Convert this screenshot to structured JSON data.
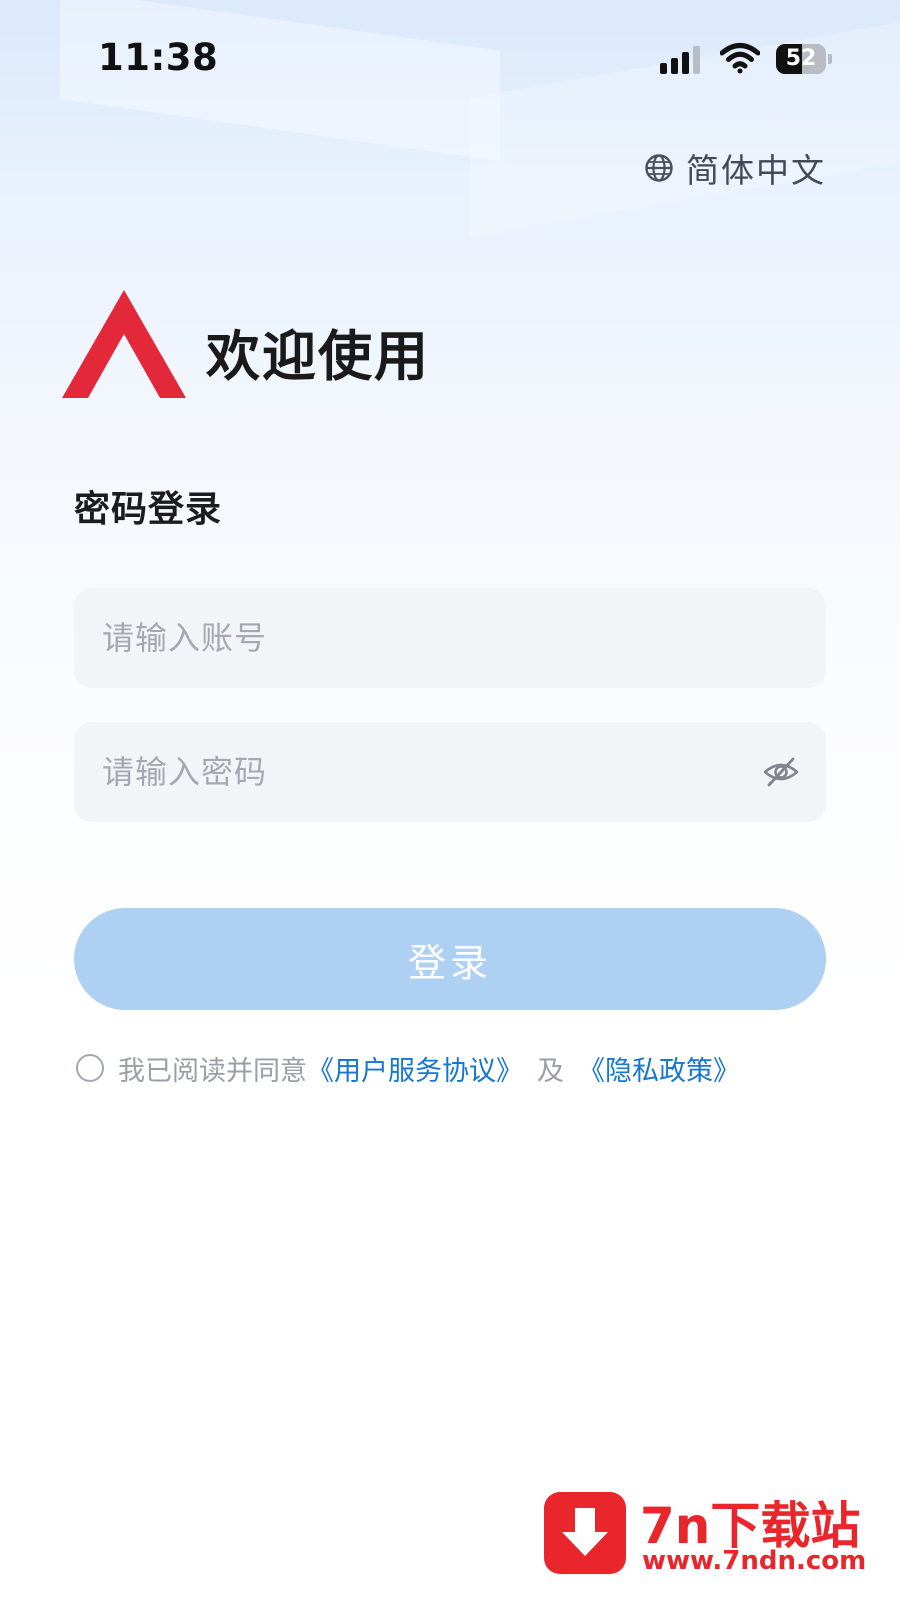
{
  "status_bar": {
    "time": "11:38",
    "battery_level": "52",
    "battery_fraction": 0.52
  },
  "language": {
    "icon": "globe-icon",
    "label": "简体中文"
  },
  "header": {
    "welcome": "欢迎使用"
  },
  "login": {
    "title": "密码登录",
    "account_placeholder": "请输入账号",
    "account_value": "",
    "password_placeholder": "请输入密码",
    "password_value": "",
    "password_toggle_icon": "eye-off-icon",
    "submit_label": "登录"
  },
  "agreement": {
    "checked": false,
    "text": "我已阅读并同意",
    "terms_link": "《用户服务协议》",
    "and": "及",
    "privacy_link": "《隐私政策》"
  },
  "watermark": {
    "brand": "7n下载站",
    "url": "www.7ndn.com"
  },
  "colors": {
    "accent": "#1677d2",
    "button_disabled": "#aed0f3",
    "logo_red": "#e3283a",
    "watermark_red": "#e8262b"
  }
}
